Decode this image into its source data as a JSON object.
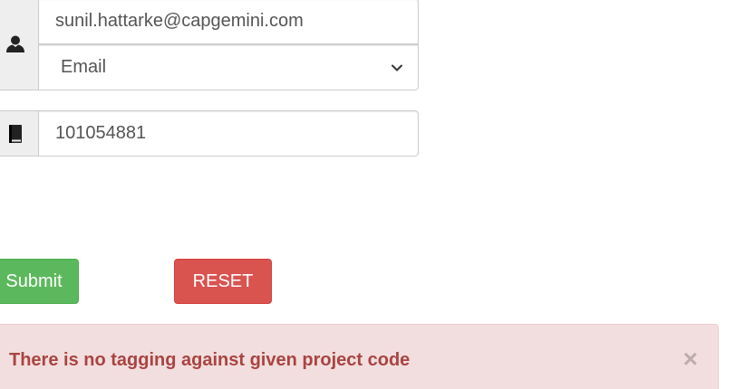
{
  "form": {
    "email_value": "sunil.hattarke@capgemini.com",
    "type_select": {
      "selected": "Email"
    },
    "project_code_value": "101054881"
  },
  "icons": {
    "user": "user-icon",
    "book": "book-icon",
    "select_caret": "chevron-down-icon",
    "close": "close-icon"
  },
  "buttons": {
    "submit_label": "Submit",
    "reset_label": "RESET"
  },
  "alert": {
    "message": "There is no tagging against given project code",
    "close_label": "×"
  },
  "colors": {
    "success": "#5cb85c",
    "danger": "#d9534f",
    "alert_bg": "#f2dede",
    "alert_text": "#a94442"
  }
}
